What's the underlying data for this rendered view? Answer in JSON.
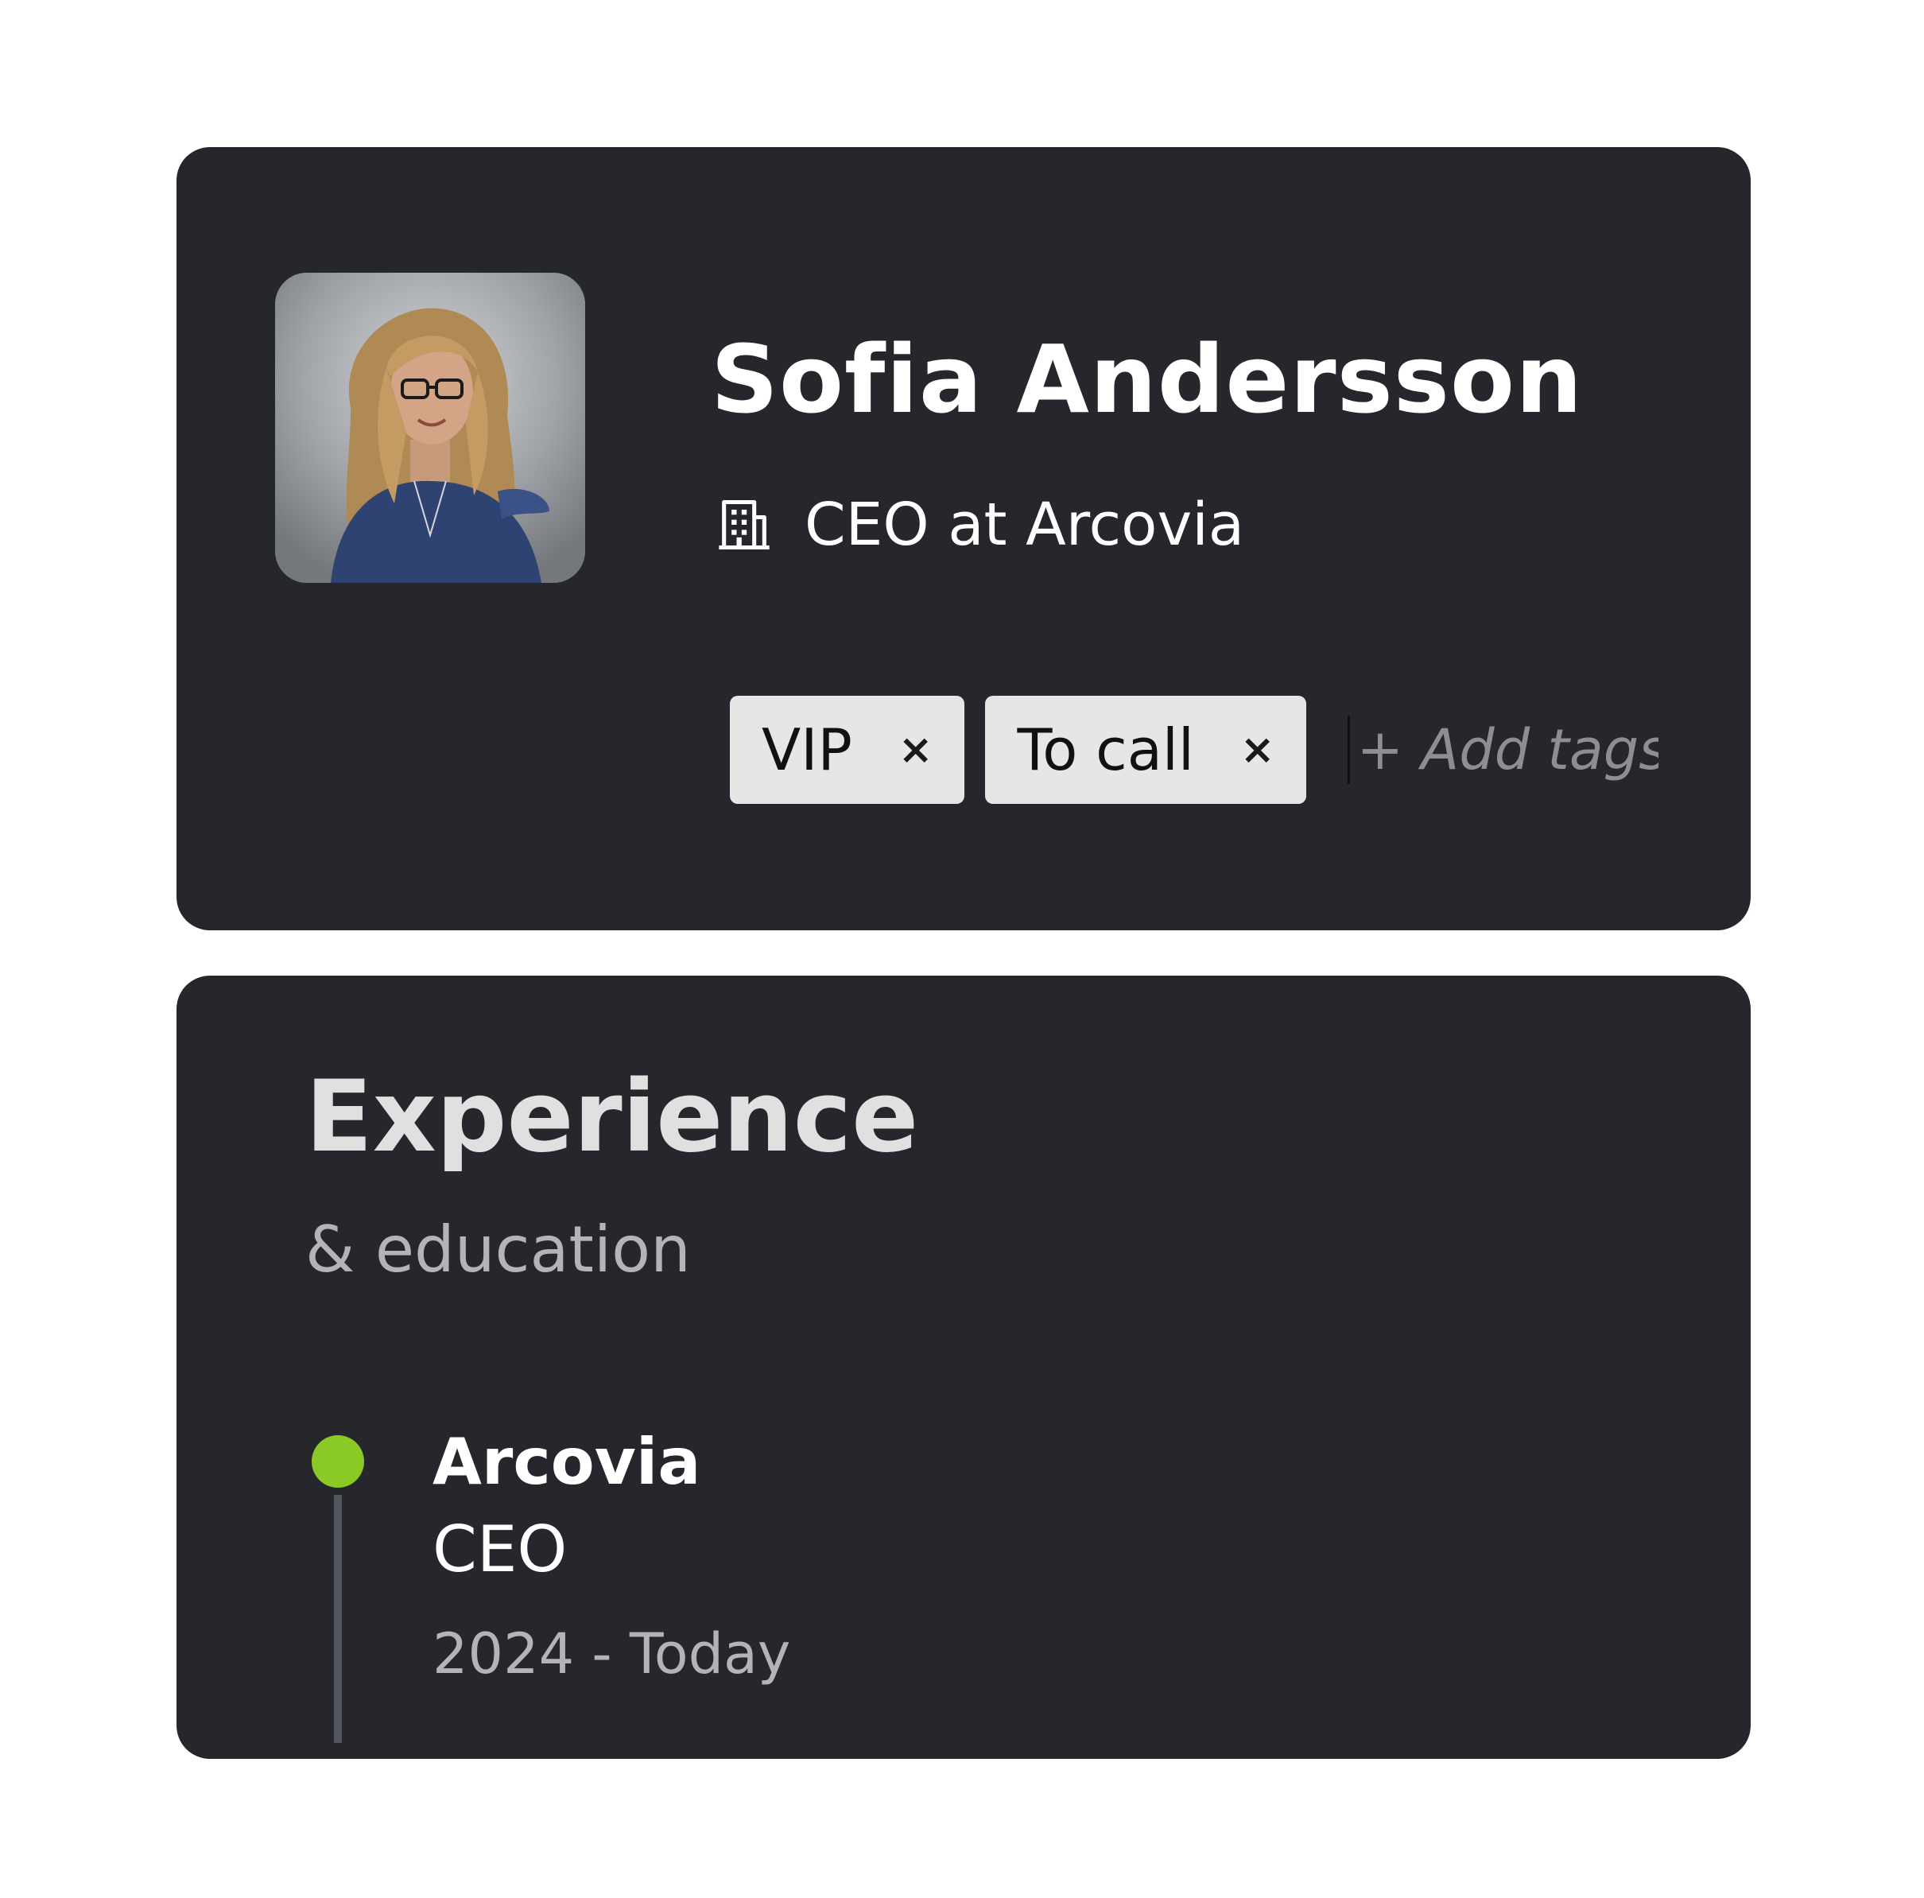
{
  "profile": {
    "first_name": "Sofia",
    "last_name": "Andersson",
    "full_name": "Sofia  Andersson",
    "role_line": "CEO at Arcovia",
    "role_icon": "building-icon",
    "avatar_icon": "person-photo",
    "tags": [
      {
        "label": "VIP",
        "remove_glyph": "×"
      },
      {
        "label": "To call",
        "remove_glyph": "×"
      }
    ],
    "add_tags_placeholder": "+ Add tags"
  },
  "experience": {
    "title": "Experience",
    "subtitle": "& education",
    "entries": [
      {
        "company": "Arcovia",
        "role": "CEO",
        "dates": "2024 - Today",
        "dot_color": "#8ac926"
      }
    ]
  },
  "colors": {
    "card_background": "#25272d",
    "tag_background": "#e6e6e6",
    "accent_green": "#8ac926",
    "muted_text": "#b3b4b7",
    "placeholder_text": "#8c8e92"
  }
}
